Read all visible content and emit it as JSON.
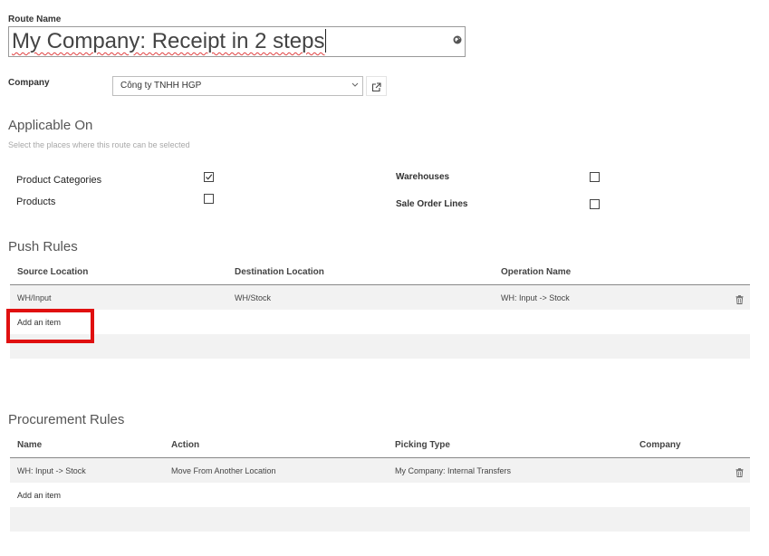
{
  "form": {
    "route_name_label": "Route Name",
    "route_name_value": "My Company: Receipt in 2 steps",
    "company_label": "Company",
    "company_value": "Công ty TNHH HGP"
  },
  "applicable_on": {
    "title": "Applicable On",
    "hint": "Select the places where this route can be selected",
    "product_categories_label": "Product Categories",
    "product_categories_checked": true,
    "products_label": "Products",
    "products_checked": false,
    "warehouses_label": "Warehouses",
    "warehouses_checked": false,
    "sale_order_lines_label": "Sale Order Lines",
    "sale_order_lines_checked": false
  },
  "push_rules": {
    "title": "Push Rules",
    "columns": [
      "Source Location",
      "Destination Location",
      "Operation Name"
    ],
    "rows": [
      [
        "WH/Input",
        "WH/Stock",
        "WH: Input -> Stock"
      ]
    ],
    "add_item_label": "Add an item"
  },
  "procurement_rules": {
    "title": "Procurement Rules",
    "columns": [
      "Name",
      "Action",
      "Picking Type",
      "Company"
    ],
    "rows": [
      [
        "WH: Input -> Stock",
        "Move From Another Location",
        "My Company: Internal Transfers",
        ""
      ]
    ],
    "add_item_label": "Add an item"
  },
  "colors": {
    "highlight": "#e01010",
    "row_background": "#f2f2f2"
  },
  "icons": {
    "route_name_translate": "globe-icon",
    "company_open": "external-link-icon",
    "row_delete": "trash-icon"
  }
}
